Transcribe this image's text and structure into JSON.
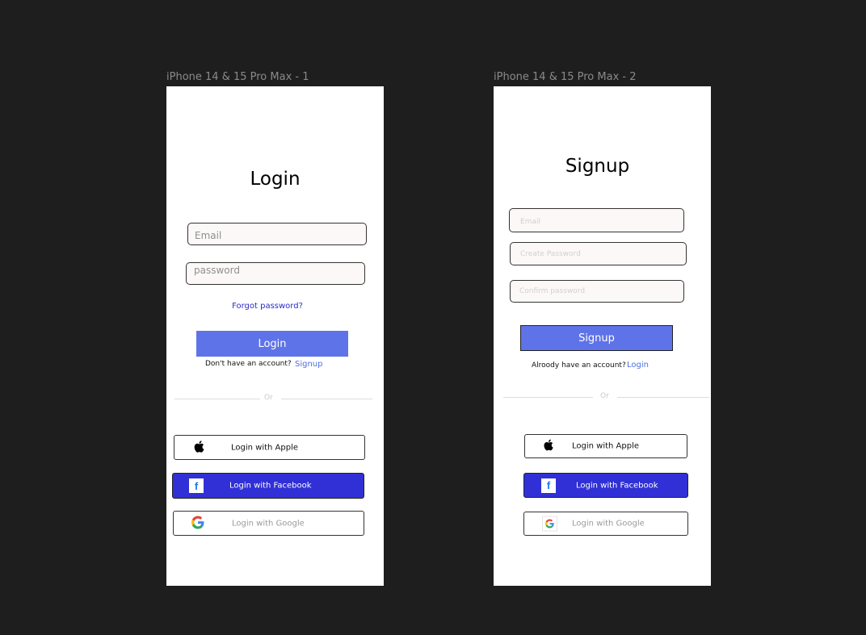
{
  "frames": [
    {
      "label": "iPhone 14 & 15 Pro Max - 1",
      "title": "Login",
      "fields": [
        {
          "placeholder": "Email"
        },
        {
          "placeholder": "password"
        }
      ],
      "forgot_link": "Forgot password?",
      "primary_button": "Login",
      "account_prompt": "Don't have an account?",
      "account_link": "Signup",
      "divider": "Or",
      "social": {
        "apple": "Login with Apple",
        "facebook": "Login with Facebook",
        "google": "Login with Google"
      }
    },
    {
      "label": "iPhone 14 & 15 Pro Max - 2",
      "title": "Signup",
      "fields": [
        {
          "placeholder": "Email"
        },
        {
          "placeholder": "Create Password"
        },
        {
          "placeholder": "Confirm password"
        }
      ],
      "primary_button": "Signup",
      "account_prompt": "Alroody have an account?",
      "account_link": "Login",
      "divider": "Or",
      "social": {
        "apple": "Login with Apple",
        "facebook": "Login with Facebook",
        "google": "Login with Google"
      }
    }
  ],
  "colors": {
    "canvas": "#1e1e1e",
    "primary": "#5f73e8",
    "facebook": "#3030d6",
    "link": "#2b2bc8"
  },
  "icons": [
    "apple-icon",
    "facebook-icon",
    "google-icon"
  ]
}
